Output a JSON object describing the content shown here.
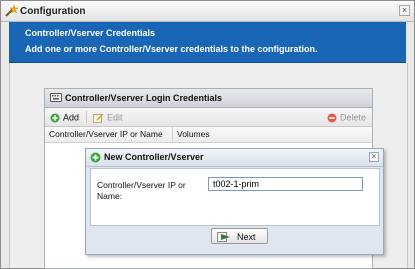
{
  "window": {
    "title": "Configuration",
    "close_glyph": "×"
  },
  "banner": {
    "title": "Controller/Vserver Credentials",
    "description": "Add one or more Controller/Vserver credentials to the configuration."
  },
  "grid": {
    "title": "Controller/Vserver Login Credentials",
    "toolbar": {
      "add_label": "Add",
      "edit_label": "Edit",
      "delete_label": "Delete"
    },
    "columns": [
      "Controller/Vserver IP or Name",
      "Volumes"
    ]
  },
  "dialog": {
    "title": "New Controller/Vserver",
    "close_glyph": "×",
    "field_label": "Controller/Vserver IP or Name:",
    "field_value": "t002-1-prim",
    "next_label": "Next"
  },
  "colors": {
    "banner": "#1a66b6",
    "add_icon": "#3aa33a",
    "delete_icon": "#e05a4a"
  },
  "icons": {
    "app": "wand-icon",
    "grid": "keyboard-icon",
    "add": "plus-circle-icon",
    "edit": "edit-icon",
    "delete": "minus-circle-icon",
    "dialog": "plus-circle-icon",
    "next": "arrow-right-icon"
  }
}
